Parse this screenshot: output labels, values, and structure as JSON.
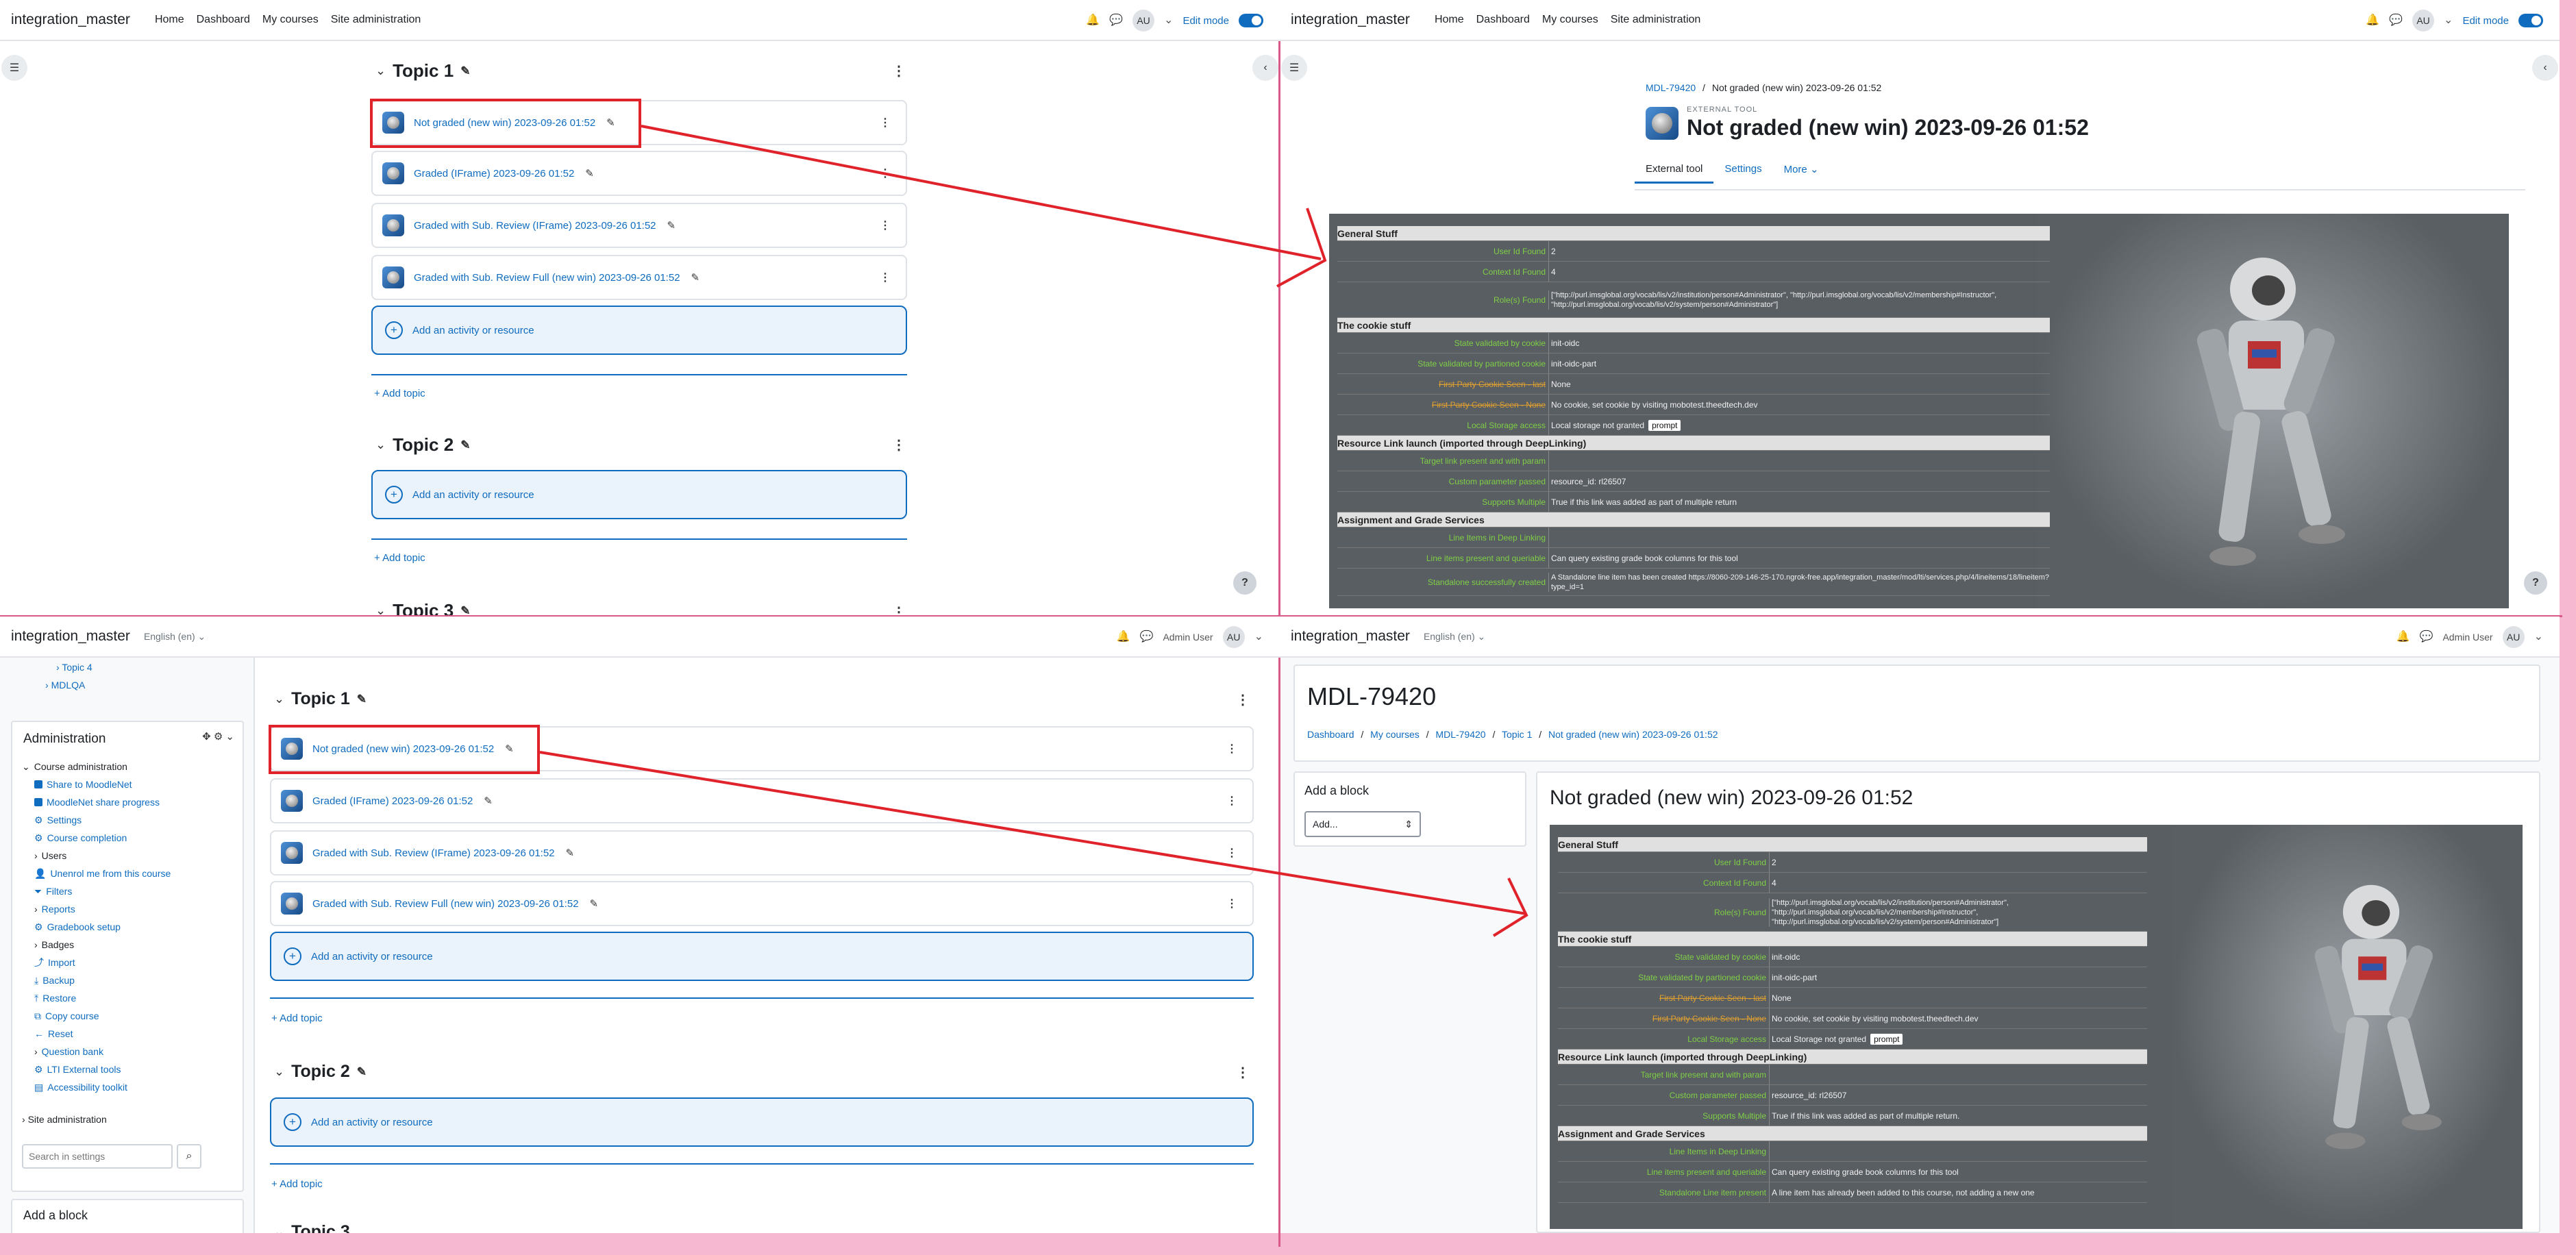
{
  "site": {
    "brand": "integration_master",
    "lang": "English (en)",
    "user": "Admin User",
    "avatar": "AU"
  },
  "nav": {
    "home": "Home",
    "dashboard": "Dashboard",
    "mycourses": "My courses",
    "siteadmin": "Site administration",
    "editmode": "Edit mode"
  },
  "course": {
    "topic1": "Topic 1",
    "topic2": "Topic 2",
    "topic3": "Topic 3",
    "activities": [
      "Not graded (new win) 2023-09-26 01:52",
      "Graded (IFrame) 2023-09-26 01:52",
      "Graded with Sub. Review (IFrame) 2023-09-26 01:52",
      "Graded with Sub. Review Full (new win) 2023-09-26 01:52"
    ],
    "add_activity": "Add an activity or resource",
    "add_topic": "Add topic"
  },
  "ext": {
    "crumb_course": "MDL-79420",
    "crumb_sep": "/",
    "crumb_page": "Not graded (new win) 2023-09-26 01:52",
    "type": "EXTERNAL TOOL",
    "title": "Not graded (new win) 2023-09-26 01:52",
    "tabs": [
      "External tool",
      "Settings",
      "More"
    ]
  },
  "lti": {
    "h_general": "General Stuff",
    "h_cookie": "The cookie stuff",
    "h_resource": "Resource Link launch (imported through DeepLinking)",
    "h_assign": "Assignment and Grade Services",
    "user_id_k": "User Id Found",
    "user_id_v": "2",
    "context_k": "Context Id Found",
    "context_v": "4",
    "roles_k": "Role(s) Found",
    "roles_v": "[\"http://purl.imsglobal.org/vocab/lis/v2/institution/person#Administrator\", \"http://purl.imsglobal.org/vocab/lis/v2/membership#Instructor\", \"http://purl.imsglobal.org/vocab/lis/v2/system/person#Administrator\"]",
    "state_k": "State validated by cookie",
    "state_v": "init-oidc",
    "statep_k": "State validated by partioned cookie",
    "statep_v": "init-oidc-part",
    "fp1_k": "First Party Cookie Seen - last",
    "fp1_v": "None",
    "fp2_k": "First Party Cookie Seen - None",
    "fp2_v": "No cookie, set cookie by visiting mobotest.theedtech.dev",
    "ls_k": "Local Storage access",
    "ls_v": "Local storage not granted",
    "ls_v2": "Local Storage not granted",
    "prompt": "prompt",
    "tlink_k": "Target link present and with param",
    "cparam_k": "Custom parameter passed",
    "cparam_v": "resource_id: rl26507",
    "multi_k": "Supports Multiple",
    "multi_v": "True if this link was added as part of multiple return",
    "multi_v2": "True if this link was added as part of multiple return.",
    "lidl_k": "Line Items in Deep Linking",
    "lipq_k": "Line items present and queriable",
    "lipq_v": "Can query existing grade book columns for this tool",
    "sac_k": "Standalone successfully created",
    "sac_v": "A Standalone line item has been created https://8060-209-146-25-170.ngrok-free.app/integration_master/mod/lti/services.php/4/lineitems/18/lineitem?type_id=1",
    "slip_k": "Standalone Line item present",
    "slip_v": "A line item has already been added to this course, not adding a new one"
  },
  "admin": {
    "topic4": "Topic 4",
    "mdlqa": "MDLQA",
    "title": "Administration",
    "course_admin": "Course administration",
    "items": [
      "Share to MoodleNet",
      "MoodleNet share progress",
      "Settings",
      "Course completion",
      "Users",
      "Unenrol me from this course",
      "Filters",
      "Reports",
      "Gradebook setup",
      "Badges",
      "Import",
      "Backup",
      "Restore",
      "Copy course",
      "Reset",
      "Question bank",
      "LTI External tools",
      "Accessibility toolkit"
    ],
    "site_admin": "Site administration",
    "search_ph": "Search in settings",
    "add_block": "Add a block"
  },
  "view": {
    "page_title": "MDL-79420",
    "crumbs": [
      "Dashboard",
      "My courses",
      "MDL-79420",
      "Topic 1",
      "Not graded (new win) 2023-09-26 01:52"
    ],
    "add_block": "Add a block",
    "add_select": "Add...",
    "activity_title": "Not graded (new win) 2023-09-26 01:52"
  }
}
